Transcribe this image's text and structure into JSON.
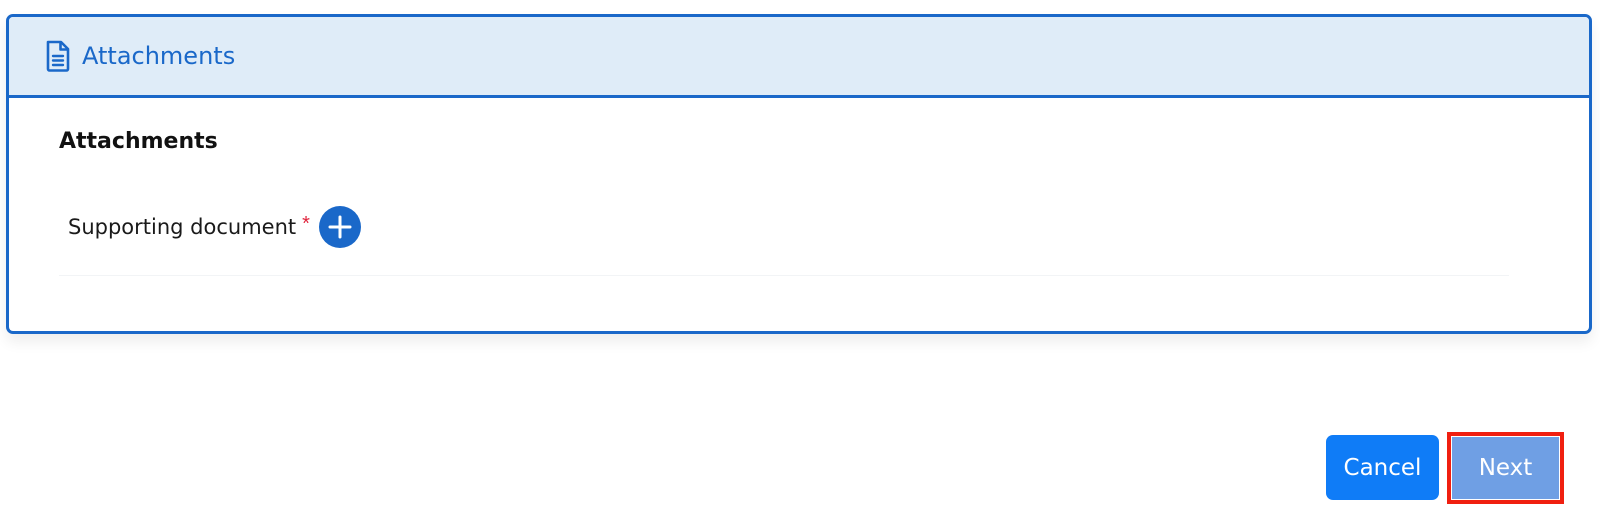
{
  "panel": {
    "header_title": "Attachments",
    "header_icon": "document-icon",
    "section_title": "Attachments",
    "field": {
      "label": "Supporting document",
      "required_marker": "*",
      "add_icon": "plus-circle-icon"
    }
  },
  "actions": {
    "cancel_label": "Cancel",
    "next_label": "Next"
  },
  "colors": {
    "primary": "#1a68c9",
    "header_bg": "#dfecf8",
    "cancel_bg": "#0f7cf7",
    "next_bg": "#6f9fe4",
    "required": "#e0233c",
    "highlight_outline": "#f01f10"
  }
}
